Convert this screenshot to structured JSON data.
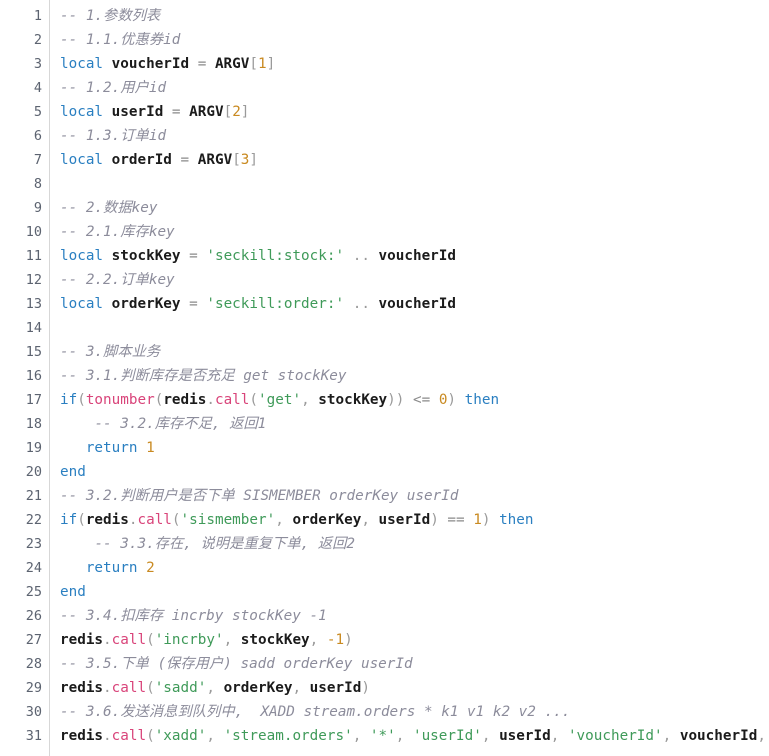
{
  "editor": {
    "language": "lua",
    "total_lines": 31,
    "colors": {
      "background": "#ffffff",
      "gutter_text": "#5c6370",
      "gutter_divider": "#d7d7d7",
      "comment": "#8c8c9b",
      "keyword": "#2a7fc1",
      "function": "#d9447a",
      "string": "#3f9a59",
      "number": "#c98a21",
      "punctuation": "#9a9a9a",
      "identifier": "#1b1b1b"
    }
  },
  "gutter": {
    "numbers": [
      "1",
      "2",
      "3",
      "4",
      "5",
      "6",
      "7",
      "8",
      "9",
      "10",
      "11",
      "12",
      "13",
      "14",
      "15",
      "16",
      "17",
      "18",
      "19",
      "20",
      "21",
      "22",
      "23",
      "24",
      "25",
      "26",
      "27",
      "28",
      "29",
      "30",
      "31"
    ]
  },
  "code": {
    "lines": [
      {
        "n": 1,
        "text": "-- 1.参数列表"
      },
      {
        "n": 2,
        "text": "-- 1.1.优惠券id"
      },
      {
        "n": 3,
        "text": "local voucherId = ARGV[1]"
      },
      {
        "n": 4,
        "text": "-- 1.2.用户id"
      },
      {
        "n": 5,
        "text": "local userId = ARGV[2]"
      },
      {
        "n": 6,
        "text": "-- 1.3.订单id"
      },
      {
        "n": 7,
        "text": "local orderId = ARGV[3]"
      },
      {
        "n": 8,
        "text": ""
      },
      {
        "n": 9,
        "text": "-- 2.数据key"
      },
      {
        "n": 10,
        "text": "-- 2.1.库存key"
      },
      {
        "n": 11,
        "text": "local stockKey = 'seckill:stock:' .. voucherId"
      },
      {
        "n": 12,
        "text": "-- 2.2.订单key"
      },
      {
        "n": 13,
        "text": "local orderKey = 'seckill:order:' .. voucherId"
      },
      {
        "n": 14,
        "text": ""
      },
      {
        "n": 15,
        "text": "-- 3.脚本业务"
      },
      {
        "n": 16,
        "text": "-- 3.1.判断库存是否充足 get stockKey"
      },
      {
        "n": 17,
        "text": "if(tonumber(redis.call('get', stockKey)) <= 0) then"
      },
      {
        "n": 18,
        "text": "    -- 3.2.库存不足, 返回1"
      },
      {
        "n": 19,
        "text": "   return 1"
      },
      {
        "n": 20,
        "text": "end"
      },
      {
        "n": 21,
        "text": "-- 3.2.判断用户是否下单 SISMEMBER orderKey userId"
      },
      {
        "n": 22,
        "text": "if(redis.call('sismember', orderKey, userId) == 1) then"
      },
      {
        "n": 23,
        "text": "    -- 3.3.存在, 说明是重复下单, 返回2"
      },
      {
        "n": 24,
        "text": "   return 2"
      },
      {
        "n": 25,
        "text": "end"
      },
      {
        "n": 26,
        "text": "-- 3.4.扣库存 incrby stockKey -1"
      },
      {
        "n": 27,
        "text": "redis.call('incrby', stockKey, -1)"
      },
      {
        "n": 28,
        "text": "-- 3.5.下单 (保存用户) sadd orderKey userId"
      },
      {
        "n": 29,
        "text": "redis.call('sadd', orderKey, userId)"
      },
      {
        "n": 30,
        "text": "-- 3.6.发送消息到队列中,  XADD stream.orders * k1 v1 k2 v2 ..."
      },
      {
        "n": 31,
        "text": "redis.call('xadd', 'stream.orders', '*', 'userId', userId, 'voucherId', voucherId,"
      }
    ]
  }
}
